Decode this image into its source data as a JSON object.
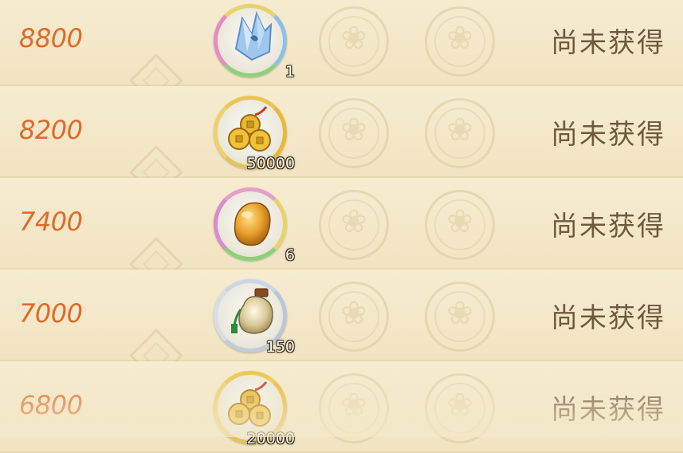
{
  "rewards": [
    {
      "score": "8800",
      "item_icon": "blue-crystal-icon",
      "ring": "rainbow",
      "quantity": "1",
      "status": "尚未获得"
    },
    {
      "score": "8200",
      "item_icon": "copper-coins-icon",
      "ring": "gold",
      "quantity": "50000",
      "status": "尚未获得"
    },
    {
      "score": "7400",
      "item_icon": "amber-stone-icon",
      "ring": "pink",
      "quantity": "6",
      "status": "尚未获得"
    },
    {
      "score": "7000",
      "item_icon": "pearl-bottle-icon",
      "ring": "silver",
      "quantity": "150",
      "status": "尚未获得"
    },
    {
      "score": "6800",
      "item_icon": "copper-coins-icon",
      "ring": "gold",
      "quantity": "20000",
      "status": "尚未获得"
    }
  ],
  "colors": {
    "background": "#f3e8c9",
    "score": "#e06a2b",
    "status": "#6f5a3d"
  }
}
